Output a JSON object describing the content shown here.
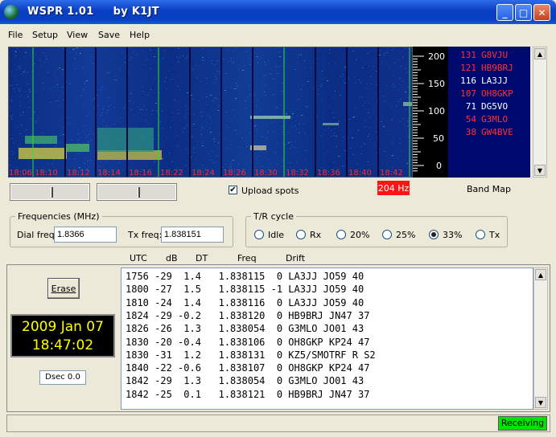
{
  "window": {
    "title": "WSPR 1.01     by K1JT"
  },
  "menu": [
    "File",
    "Setup",
    "View",
    "Save",
    "Help"
  ],
  "waterfall": {
    "time_labels": [
      "18:06",
      "18:10",
      "18:12",
      "18:14",
      "18:16",
      "18:22",
      "18:24",
      "18:26",
      "18:30",
      "18:32",
      "18:36",
      "18:40",
      "18:42"
    ]
  },
  "freq_scale": [
    "200",
    "150",
    "100",
    "50",
    "0"
  ],
  "band_map": [
    {
      "snr": "131",
      "call": "G8VJU",
      "color": "#ff3030"
    },
    {
      "snr": "121",
      "call": "HB9BRJ",
      "color": "#ff3030"
    },
    {
      "snr": "116",
      "call": "LA3JJ",
      "color": "#ffffff"
    },
    {
      "snr": "107",
      "call": "OH8GKP",
      "color": "#ff3030"
    },
    {
      "snr": "71",
      "call": "DG5VO",
      "color": "#ffffff"
    },
    {
      "snr": "54",
      "call": "G3MLO",
      "color": "#ff3030"
    },
    {
      "snr": "38",
      "call": "GW4BVE",
      "color": "#ff3030"
    }
  ],
  "controls": {
    "upload_spots": "Upload spots",
    "hz_badge": "204 Hz",
    "band_map_label": "Band Map"
  },
  "frequencies": {
    "legend": "Frequencies (MHz)",
    "dial_label": "Dial freq:",
    "dial_value": "1.8366",
    "tx_label": "Tx freq:",
    "tx_value": "1.838151"
  },
  "tr_cycle": {
    "legend": "T/R cycle",
    "options": [
      "Idle",
      "Rx",
      "20%",
      "25%",
      "33%",
      "Tx"
    ],
    "selected": "33%"
  },
  "columns": [
    "UTC",
    "dB",
    "DT",
    "Freq",
    "Drift"
  ],
  "decodes": [
    "1756 -29  1.4   1.838115  0 LA3JJ JO59 40",
    "1800 -27  1.5   1.838115 -1 LA3JJ JO59 40",
    "1810 -24  1.4   1.838116  0 LA3JJ JO59 40",
    "1824 -29 -0.2   1.838120  0 HB9BRJ JN47 37",
    "1826 -26  1.3   1.838054  0 G3MLO JO01 43",
    "1830 -20 -0.4   1.838106  0 OH8GKP KP24 47",
    "1830 -31  1.2   1.838131  0 KZ5/SMOTRF R S2",
    "1840 -22 -0.6   1.838107  0 OH8GKP KP24 47",
    "1842 -29  1.3   1.838054  0 G3MLO JO01 43",
    "1842 -25  0.1   1.838121  0 HB9BRJ JN47 37"
  ],
  "left_panel": {
    "erase": "Erase",
    "date": "2009 Jan 07",
    "time": "18:47:02",
    "dsec": "Dsec  0.0"
  },
  "status": {
    "receiving": "Receiving"
  }
}
